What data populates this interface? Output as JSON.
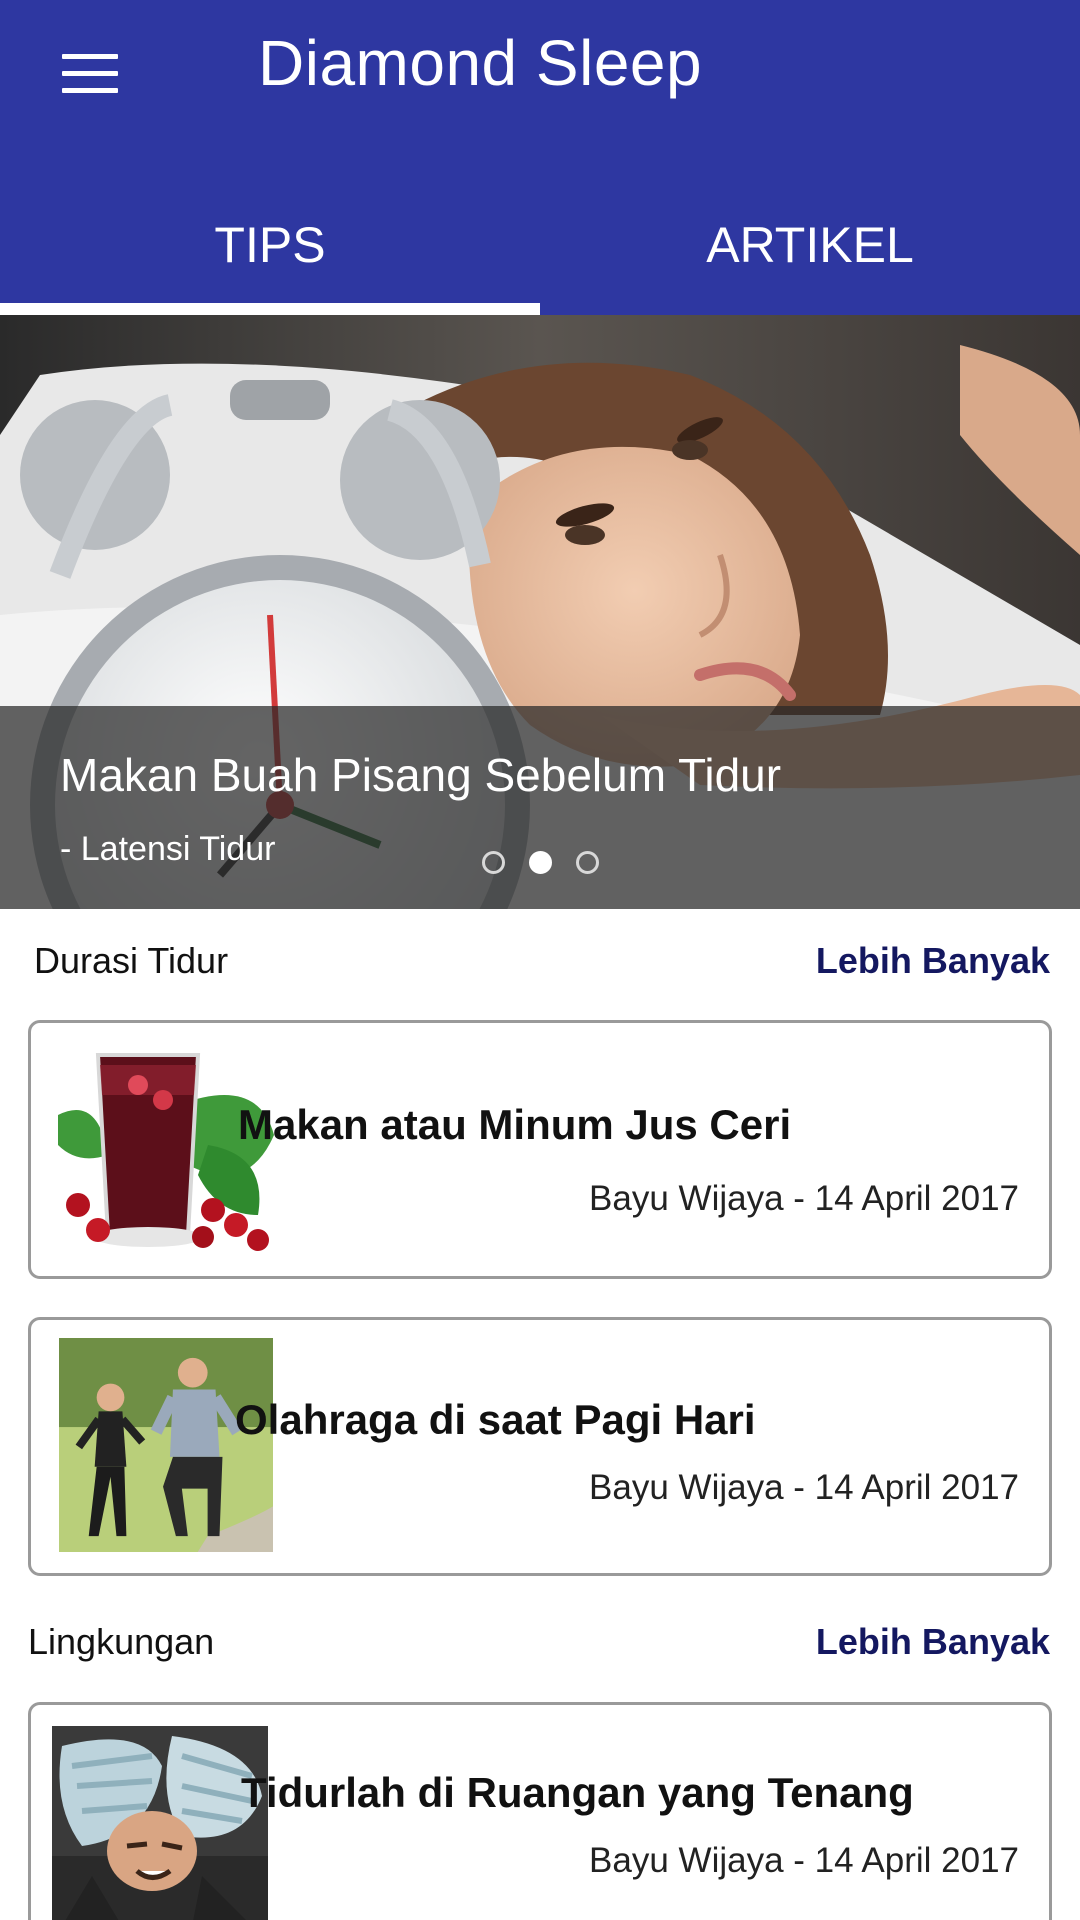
{
  "app": {
    "title": "Diamond Sleep",
    "accent_color": "#2e37a1",
    "menu_icon": "hamburger-menu-icon"
  },
  "tabs": [
    {
      "label": "TIPS",
      "selected": true
    },
    {
      "label": "ARTIKEL",
      "selected": false
    }
  ],
  "hero": {
    "title": "Makan Buah Pisang Sebelum Tidur",
    "subtitle": "- Latensi Tidur",
    "slide_count": 3,
    "active_slide": 2
  },
  "sections": [
    {
      "title": "Durasi Tidur",
      "more_label": "Lebih Banyak",
      "cards": [
        {
          "title": "Makan atau Minum Jus Ceri",
          "meta": "Bayu Wijaya - 14 April 2017",
          "image": "cherry-juice-image"
        },
        {
          "title": "Olahraga di saat Pagi Hari",
          "meta": "Bayu Wijaya - 14 April 2017",
          "image": "morning-jog-image"
        }
      ]
    },
    {
      "title": "Lingkungan",
      "more_label": "Lebih Banyak",
      "cards": [
        {
          "title": "Tidurlah di Ruangan yang Tenang",
          "meta": "Bayu Wijaya - 14 April 2017",
          "image": "noise-pillow-image"
        }
      ]
    }
  ]
}
